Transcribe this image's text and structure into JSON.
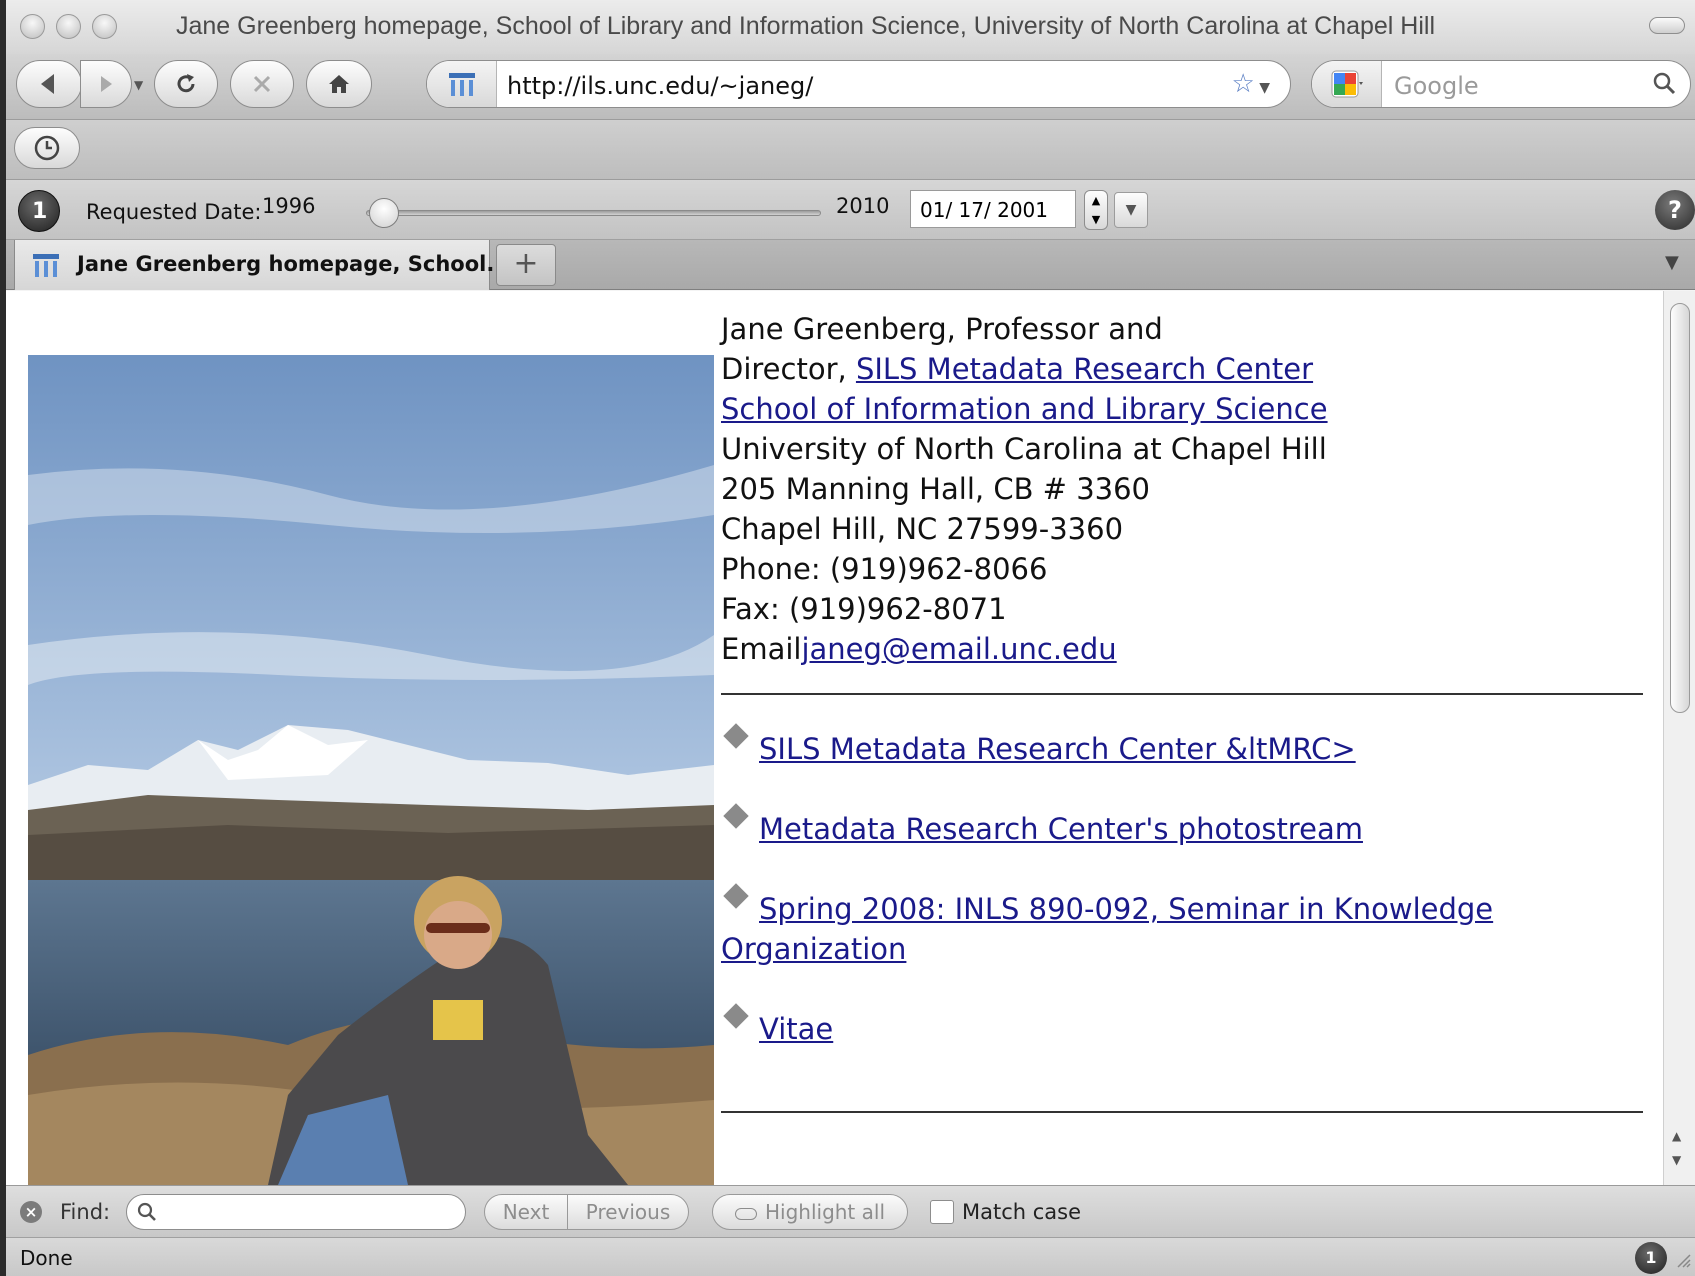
{
  "window": {
    "title": "Jane Greenberg homepage, School of Library and Information Science, University of North Carolina at Chapel Hill"
  },
  "navbar": {
    "url": "http://ils.unc.edu/~janeg/",
    "search_placeholder": "Google"
  },
  "wayback": {
    "requested_label": "Requested Date:",
    "year_start": "1996",
    "year_end": "2010",
    "date_value": "01/ 17/ 2001",
    "slider_position": 0.04
  },
  "tab": {
    "label": "Jane Greenberg homepage, School...",
    "new_tab": "+"
  },
  "profile": {
    "line1": "Jane Greenberg, Professor and",
    "director_prefix": "Director, ",
    "director_link": "SILS Metadata Research Center",
    "school_link": "School of Information and Library Science",
    "university": "University of North Carolina at Chapel Hill",
    "address1": "205 Manning Hall, CB # 3360",
    "address2": "Chapel Hill, NC 27599-3360",
    "phone": "Phone: (919)962-8066",
    "fax": "Fax: (919)962-8071",
    "email_label": "Email",
    "email": "janeg@email.unc.edu"
  },
  "links": [
    {
      "text": "SILS Metadata Research Center &ltMRC>"
    },
    {
      "text": "Metadata Research Center's photostream"
    },
    {
      "text": "Spring 2008: INLS 890-092, Seminar in Knowledge Organization"
    },
    {
      "text": "Vitae"
    }
  ],
  "findbar": {
    "label": "Find:",
    "next": "Next",
    "previous": "Previous",
    "highlight_all": "Highlight all",
    "match_case": "Match case"
  },
  "status": {
    "text": "Done"
  },
  "colors": {
    "link": "#1a1a8a",
    "chrome": "#d0d0d0"
  }
}
